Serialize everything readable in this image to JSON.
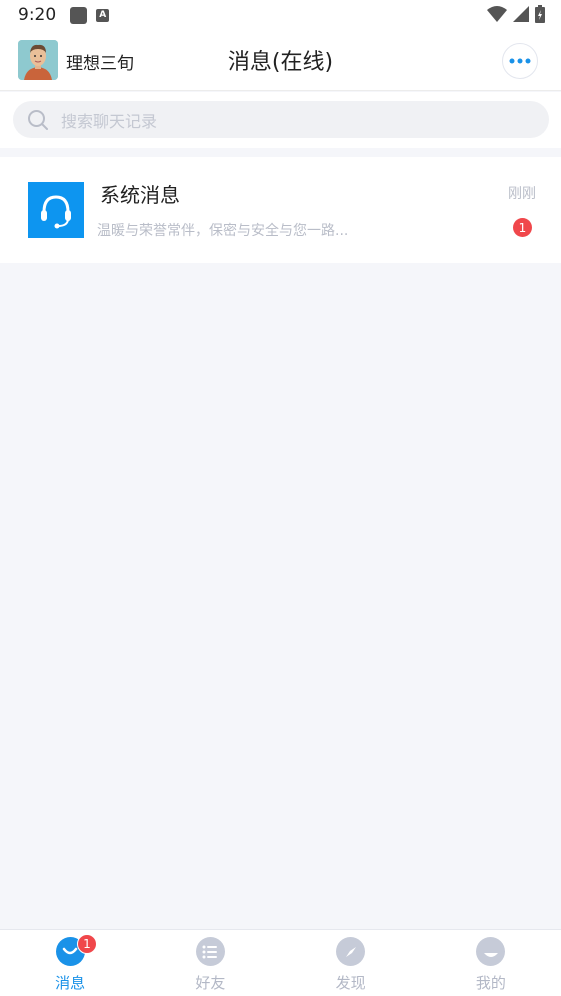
{
  "status_bar": {
    "time": "9:20",
    "icons": [
      "notification-square-icon",
      "a-badge-icon",
      "wifi-icon",
      "signal-icon",
      "battery-charging-icon"
    ]
  },
  "header": {
    "user_name": "理想三旬",
    "title": "消息(在线)",
    "more_icon": "more-dots-icon"
  },
  "search": {
    "placeholder": "搜索聊天记录"
  },
  "chats": [
    {
      "name": "系统消息",
      "preview": "温暖与荣誉常伴，保密与安全与您一路...",
      "time": "刚刚",
      "unread": "1",
      "avatar_icon": "headset-icon"
    }
  ],
  "tabs": [
    {
      "label": "消息",
      "icon": "chat-bubble-icon",
      "active": true,
      "badge": "1"
    },
    {
      "label": "好友",
      "icon": "list-icon",
      "active": false
    },
    {
      "label": "发现",
      "icon": "compass-icon",
      "active": false
    },
    {
      "label": "我的",
      "icon": "profile-icon",
      "active": false
    }
  ],
  "colors": {
    "accent": "#1a92e8",
    "badge": "#f0474b",
    "system_avatar": "#0d95f0",
    "background": "#f5f6fa"
  }
}
